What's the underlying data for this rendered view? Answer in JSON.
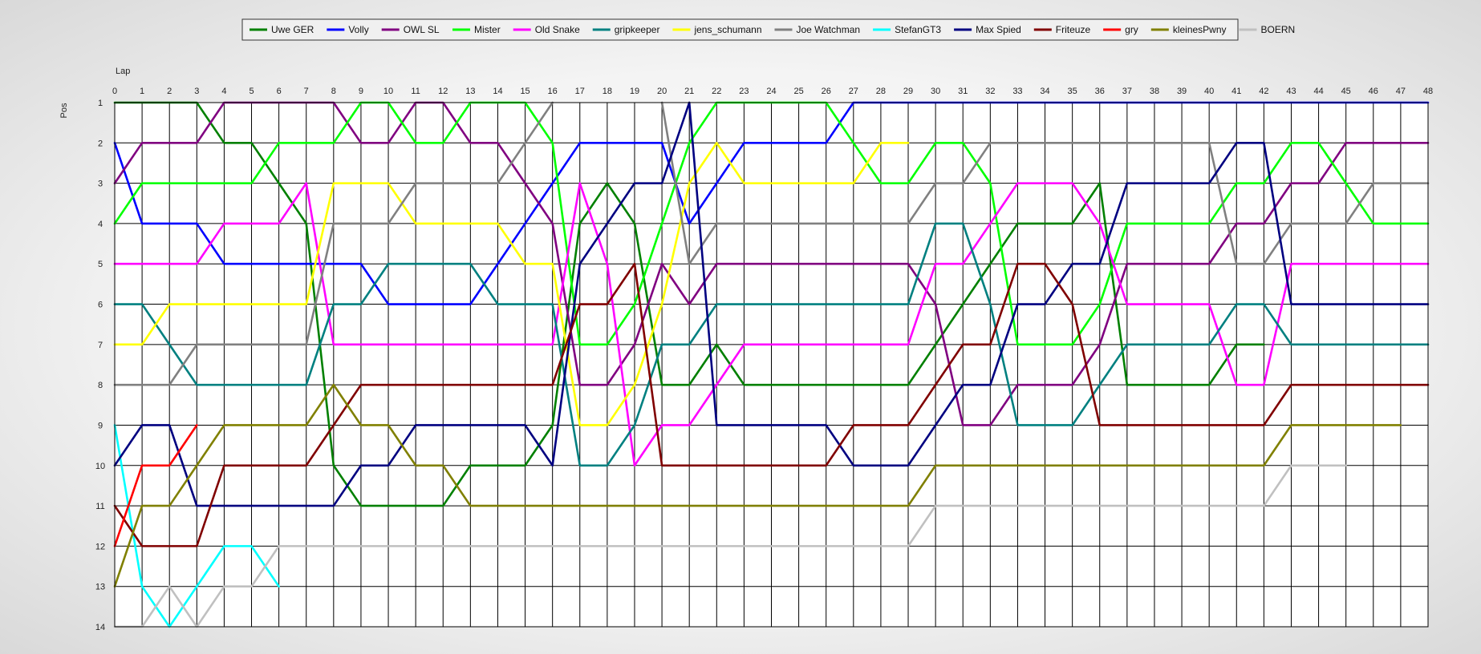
{
  "chart_data": {
    "type": "line",
    "title": "",
    "xlabel": "Lap",
    "ylabel": "Pos",
    "xlim": [
      0,
      48
    ],
    "ylim": [
      1,
      14
    ],
    "y_inverted": true,
    "grid": true,
    "legend_position": "top-center",
    "x_ticks": [
      0,
      1,
      2,
      3,
      4,
      5,
      6,
      7,
      8,
      9,
      10,
      11,
      12,
      13,
      14,
      15,
      16,
      17,
      18,
      19,
      20,
      21,
      22,
      23,
      24,
      25,
      26,
      27,
      28,
      29,
      30,
      31,
      32,
      33,
      34,
      35,
      36,
      37,
      38,
      39,
      40,
      41,
      42,
      43,
      44,
      45,
      46,
      47,
      48
    ],
    "y_ticks": [
      1,
      2,
      3,
      4,
      5,
      6,
      7,
      8,
      9,
      10,
      11,
      12,
      13,
      14
    ],
    "series": [
      {
        "name": "Uwe GER",
        "color": "#008000",
        "values": [
          1,
          1,
          1,
          1,
          2,
          2,
          3,
          4,
          10,
          11,
          11,
          11,
          11,
          10,
          10,
          10,
          9,
          4,
          3,
          4,
          8,
          8,
          7,
          8,
          8,
          8,
          8,
          8,
          8,
          8,
          7,
          6,
          5,
          4,
          4,
          4,
          3,
          8,
          8,
          8,
          8,
          7,
          7,
          null,
          null,
          null,
          null,
          null,
          null
        ]
      },
      {
        "name": "Volly",
        "color": "#0000ff",
        "values": [
          2,
          4,
          4,
          4,
          5,
          5,
          5,
          5,
          5,
          5,
          6,
          6,
          6,
          6,
          5,
          4,
          3,
          2,
          2,
          2,
          2,
          4,
          3,
          2,
          2,
          2,
          2,
          1,
          1,
          1,
          1,
          1,
          1,
          1,
          1,
          1,
          1,
          1,
          1,
          1,
          1,
          1,
          1,
          1,
          1,
          1,
          1,
          1,
          1
        ]
      },
      {
        "name": "OWL SL",
        "color": "#800080",
        "values": [
          3,
          2,
          2,
          2,
          1,
          1,
          1,
          1,
          1,
          2,
          2,
          1,
          1,
          2,
          2,
          3,
          4,
          8,
          8,
          7,
          5,
          6,
          5,
          5,
          5,
          5,
          5,
          5,
          5,
          5,
          6,
          9,
          9,
          8,
          8,
          8,
          7,
          5,
          5,
          5,
          5,
          4,
          4,
          3,
          3,
          2,
          2,
          2,
          2
        ]
      },
      {
        "name": "Mister",
        "color": "#00ff00",
        "values": [
          4,
          3,
          3,
          3,
          3,
          3,
          2,
          2,
          2,
          1,
          1,
          2,
          2,
          1,
          1,
          1,
          2,
          7,
          7,
          6,
          4,
          2,
          1,
          1,
          1,
          1,
          1,
          2,
          3,
          3,
          2,
          2,
          3,
          7,
          7,
          7,
          6,
          4,
          4,
          4,
          4,
          3,
          3,
          2,
          2,
          3,
          4,
          4,
          4
        ]
      },
      {
        "name": "Old Snake",
        "color": "#ff00ff",
        "values": [
          5,
          5,
          5,
          5,
          4,
          4,
          4,
          3,
          7,
          7,
          7,
          7,
          7,
          7,
          7,
          7,
          7,
          3,
          5,
          10,
          9,
          9,
          8,
          7,
          7,
          7,
          7,
          7,
          7,
          7,
          5,
          5,
          4,
          3,
          3,
          3,
          4,
          6,
          6,
          6,
          6,
          8,
          8,
          5,
          5,
          5,
          5,
          5,
          5
        ]
      },
      {
        "name": "gripkeeper",
        "color": "#008080",
        "values": [
          6,
          6,
          7,
          8,
          8,
          8,
          8,
          8,
          6,
          6,
          5,
          5,
          5,
          5,
          6,
          6,
          6,
          10,
          10,
          9,
          7,
          7,
          6,
          6,
          6,
          6,
          6,
          6,
          6,
          6,
          4,
          4,
          6,
          9,
          9,
          9,
          8,
          7,
          7,
          7,
          7,
          6,
          6,
          7,
          7,
          7,
          7,
          7,
          7
        ]
      },
      {
        "name": "jens_schumann",
        "color": "#ffff00",
        "values": [
          7,
          7,
          6,
          6,
          6,
          6,
          6,
          6,
          3,
          3,
          3,
          4,
          4,
          4,
          4,
          5,
          5,
          9,
          9,
          8,
          6,
          3,
          2,
          3,
          3,
          3,
          3,
          3,
          2,
          2,
          null,
          null,
          null,
          null,
          null,
          null,
          null,
          null,
          null,
          null,
          null,
          null,
          null,
          null,
          null,
          null,
          null,
          null,
          null
        ]
      },
      {
        "name": "Joe Watchman",
        "color": "#808080",
        "values": [
          8,
          8,
          8,
          7,
          7,
          7,
          7,
          7,
          4,
          4,
          4,
          3,
          3,
          3,
          3,
          2,
          1,
          null,
          null,
          null,
          1,
          5,
          4,
          4,
          4,
          4,
          4,
          4,
          4,
          4,
          3,
          3,
          2,
          2,
          2,
          2,
          2,
          2,
          2,
          2,
          2,
          5,
          5,
          4,
          4,
          4,
          3,
          3,
          3
        ]
      },
      {
        "name": "StefanGT3",
        "color": "#00ffff",
        "values": [
          9,
          13,
          14,
          13,
          12,
          12,
          13,
          null,
          null,
          null,
          null,
          null,
          null,
          null,
          null,
          null,
          null,
          null,
          null,
          null,
          null,
          null,
          null,
          null,
          null,
          null,
          null,
          null,
          null,
          null,
          null,
          null,
          null,
          null,
          null,
          null,
          null,
          null,
          null,
          null,
          null,
          null,
          null,
          null,
          null,
          null,
          null,
          null,
          null
        ]
      },
      {
        "name": "Max Spied",
        "color": "#000080",
        "values": [
          10,
          9,
          9,
          11,
          11,
          11,
          11,
          11,
          11,
          10,
          10,
          9,
          9,
          9,
          9,
          9,
          10,
          5,
          4,
          3,
          3,
          1,
          9,
          9,
          9,
          9,
          9,
          10,
          10,
          10,
          9,
          8,
          8,
          6,
          6,
          5,
          5,
          3,
          3,
          3,
          3,
          2,
          2,
          6,
          6,
          6,
          6,
          6,
          6
        ]
      },
      {
        "name": "Friteuze",
        "color": "#800000",
        "values": [
          11,
          12,
          12,
          12,
          10,
          10,
          10,
          10,
          9,
          8,
          8,
          8,
          8,
          8,
          8,
          8,
          8,
          6,
          6,
          5,
          10,
          10,
          10,
          10,
          10,
          10,
          10,
          9,
          9,
          9,
          8,
          7,
          7,
          5,
          5,
          6,
          9,
          9,
          9,
          9,
          9,
          9,
          9,
          8,
          8,
          8,
          8,
          8,
          8
        ]
      },
      {
        "name": "gry",
        "color": "#ff0000",
        "values": [
          12,
          10,
          10,
          9,
          null,
          null,
          null,
          null,
          null,
          null,
          null,
          null,
          null,
          null,
          null,
          null,
          null,
          null,
          null,
          null,
          null,
          null,
          null,
          null,
          null,
          null,
          null,
          null,
          null,
          null,
          null,
          null,
          null,
          null,
          null,
          null,
          null,
          null,
          null,
          null,
          null,
          null,
          null,
          null,
          null,
          null,
          null,
          null,
          null
        ]
      },
      {
        "name": "kleinesPwny",
        "color": "#808000",
        "values": [
          13,
          11,
          11,
          10,
          9,
          9,
          9,
          9,
          8,
          9,
          9,
          10,
          10,
          11,
          11,
          11,
          11,
          11,
          11,
          11,
          11,
          11,
          11,
          11,
          11,
          11,
          11,
          11,
          11,
          11,
          10,
          10,
          10,
          10,
          10,
          10,
          10,
          10,
          10,
          10,
          10,
          10,
          10,
          9,
          9,
          9,
          9,
          9,
          null
        ]
      },
      {
        "name": "BOERN",
        "color": "#c0c0c0",
        "values": [
          14,
          14,
          13,
          14,
          13,
          13,
          12,
          12,
          12,
          12,
          12,
          12,
          12,
          12,
          12,
          12,
          12,
          12,
          12,
          12,
          12,
          12,
          12,
          12,
          12,
          12,
          12,
          12,
          12,
          12,
          11,
          11,
          11,
          11,
          11,
          11,
          11,
          11,
          11,
          11,
          11,
          11,
          11,
          10,
          10,
          10,
          null,
          null,
          null
        ]
      }
    ]
  }
}
